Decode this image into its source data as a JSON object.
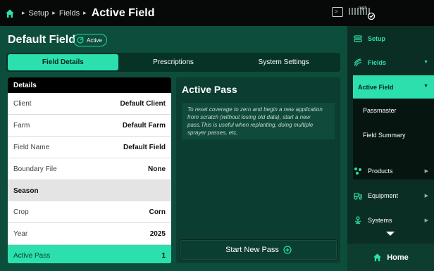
{
  "breadcrumb": {
    "items": [
      "Setup",
      "Fields"
    ],
    "current": "Active Field"
  },
  "status": {
    "speed_value": "",
    "speed_unit": "mph"
  },
  "field": {
    "name": "Default Field",
    "badge": "Active"
  },
  "tabs": [
    {
      "label": "Field Details",
      "selected": true
    },
    {
      "label": "Prescriptions",
      "selected": false
    },
    {
      "label": "System Settings",
      "selected": false
    }
  ],
  "details": {
    "header": "Details",
    "rows": [
      {
        "key": "Client",
        "value": "Default Client"
      },
      {
        "key": "Farm",
        "value": "Default Farm"
      },
      {
        "key": "Field Name",
        "value": "Default Field"
      },
      {
        "key": "Boundary File",
        "value": "None"
      }
    ],
    "season_header": "Season",
    "season_rows": [
      {
        "key": "Crop",
        "value": "Corn"
      },
      {
        "key": "Year",
        "value": "2025"
      },
      {
        "key": "Active Pass",
        "value": "1"
      }
    ]
  },
  "active_pass": {
    "title": "Active Pass",
    "note": "To reset coverage to zero and begin a new application from scratch (without losing old data), start a new pass.This is useful when replanting, doing multiple sprayer passes, etc,",
    "button": "Start New Pass"
  },
  "sidebar": {
    "setup": "Setup",
    "fields": "Fields",
    "fields_sub": {
      "active": "Active Field",
      "items": [
        "Passmaster",
        "Field Summary"
      ]
    },
    "products": "Products",
    "equipment": "Equipment",
    "systems": "Systems",
    "home": "Home"
  },
  "colors": {
    "accent": "#2be0ad",
    "panel": "#0d4d3b",
    "sidebar": "#0b2e24"
  }
}
